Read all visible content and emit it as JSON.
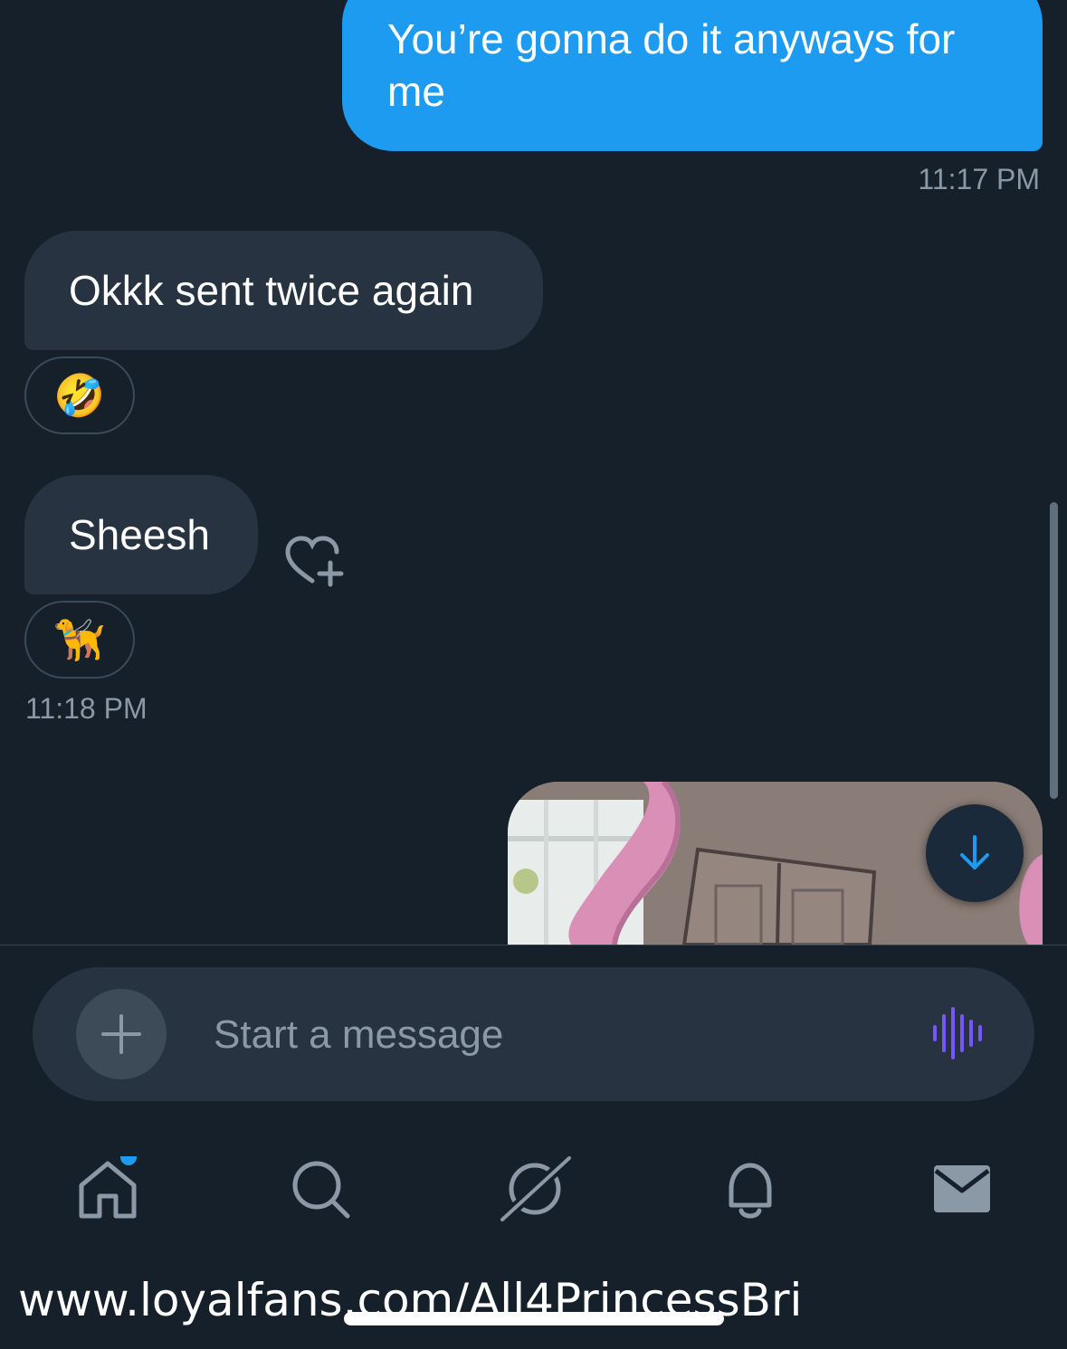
{
  "messages": {
    "outgoing_1": {
      "text": "You’re gonna do it anyways for me",
      "timestamp": "11:17 PM"
    },
    "incoming_1": {
      "text": "Okkk sent twice again",
      "reaction": "🤣"
    },
    "incoming_2": {
      "text": "Sheesh",
      "reaction": "🦮",
      "timestamp": "11:18 PM"
    }
  },
  "composer": {
    "placeholder": "Start a message"
  },
  "bottom_nav": {
    "items": [
      {
        "name": "home",
        "icon": "home-icon",
        "has_notification_dot": true
      },
      {
        "name": "search",
        "icon": "search-icon"
      },
      {
        "name": "spaces",
        "icon": "spaces-icon"
      },
      {
        "name": "notifications",
        "icon": "bell-icon"
      },
      {
        "name": "messages",
        "icon": "mail-icon"
      }
    ]
  },
  "watermark": {
    "text": "www.loyalfans.com/All4PrincessBri"
  },
  "colors": {
    "background": "#15202b",
    "outgoing_bubble": "#1d9bf0",
    "incoming_bubble": "#273340",
    "accent": "#1d9bf0",
    "voice_icon": "#7856ff"
  }
}
